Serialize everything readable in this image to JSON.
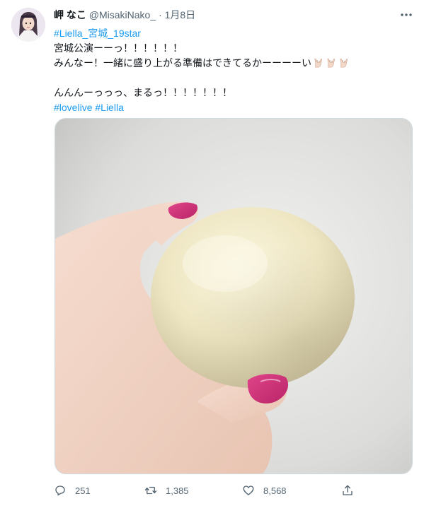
{
  "tweet": {
    "display_name": "岬 なこ",
    "handle": "@MisakiNako_",
    "separator": "·",
    "date": "1月8日",
    "avatar_icon": "user-avatar-photo",
    "more_icon": "more-options-icon",
    "text": {
      "line1": "#Liella_宮城_19star",
      "line2": "宮城公演ーーっ！！！！！！",
      "line3": "みんなー！一緒に盛り上がる準備はできてるかーーーーい",
      "line4": "んんんーっっっ、まるっ！！！！！！！",
      "hashtag1": "#lovelive",
      "hashtag2": "#Liella",
      "emoji": "love-you-gesture-emoji",
      "emoji_count": 3
    },
    "media": {
      "type": "photo",
      "description_icon": "photo-hand-holding-round-bun"
    },
    "stats": {
      "replies": "251",
      "retweets": "1,385",
      "likes": "8,568"
    },
    "colors": {
      "link": "#1d9bf0",
      "secondary_text": "#536471",
      "border": "#cfd9de"
    }
  }
}
